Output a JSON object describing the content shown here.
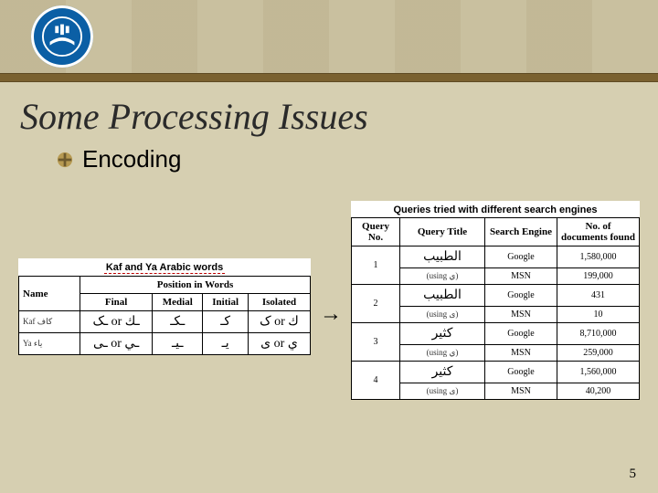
{
  "header": {
    "title": "Some Processing Issues"
  },
  "bullet": {
    "label": "Encoding"
  },
  "arrow": "→",
  "page_number": "5",
  "left_table": {
    "caption": "Kaf and Ya Arabic words",
    "super_header": "Position in Words",
    "cols": [
      "Name",
      "Final",
      "Medial",
      "Initial",
      "Isolated"
    ],
    "rows": [
      {
        "name": "Kaf   كاف",
        "final": "ـك or ـک",
        "medial": "ـكـ",
        "initial": "كـ",
        "isolated": "ك or ک"
      },
      {
        "name": "Ya    ياء",
        "final": "ـي or ـى",
        "medial": "ـيـ",
        "initial": "يـ",
        "isolated": "ي or ى"
      }
    ]
  },
  "right_table": {
    "caption": "Queries tried with different search engines",
    "cols": [
      "Query No.",
      "Query Title",
      "Search Engine",
      "No. of documents found"
    ],
    "rows": [
      {
        "no": "1",
        "title_a": "الطبيب",
        "using": "(using ي)",
        "se_a": "Google",
        "cnt_a": "1,580,000",
        "se_b": "MSN",
        "cnt_b": "199,000"
      },
      {
        "no": "2",
        "title_a": "الطبيب",
        "using": "(using ی)",
        "se_a": "Google",
        "cnt_a": "431",
        "se_b": "MSN",
        "cnt_b": "10"
      },
      {
        "no": "3",
        "title_a": "كثير",
        "using": "(using ي)",
        "se_a": "Google",
        "cnt_a": "8,710,000",
        "se_b": "MSN",
        "cnt_b": "259,000"
      },
      {
        "no": "4",
        "title_a": "كثير",
        "using": "(using ی)",
        "se_a": "Google",
        "cnt_a": "1,560,000",
        "se_b": "MSN",
        "cnt_b": "40,200"
      }
    ]
  }
}
